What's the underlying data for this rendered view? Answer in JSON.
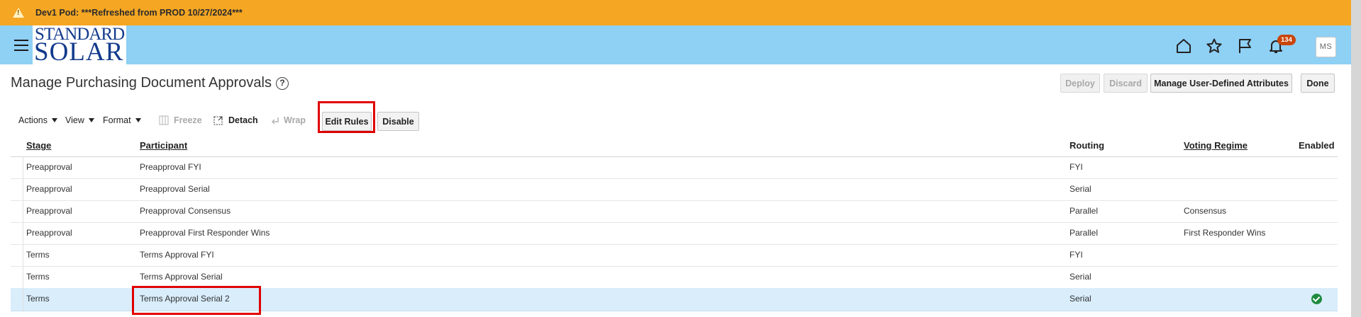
{
  "banner": {
    "text": "Dev1 Pod: ***Refreshed from PROD 10/27/2024***"
  },
  "header": {
    "logo_line1": "STANDARD",
    "logo_line2": "SOLAR",
    "notifications_count": "134",
    "user_initials": "MS",
    "icons": [
      "menu-icon",
      "home-icon",
      "star-icon",
      "flag-icon",
      "bell-icon"
    ]
  },
  "page": {
    "title": "Manage Purchasing Document Approvals"
  },
  "actions": {
    "deploy": "Deploy",
    "discard": "Discard",
    "manage_attrs": "Manage User-Defined Attributes",
    "done": "Done"
  },
  "toolbar": {
    "actions": "Actions",
    "view": "View",
    "format": "Format",
    "freeze": "Freeze",
    "detach": "Detach",
    "wrap": "Wrap",
    "edit_rules": "Edit Rules",
    "disable": "Disable"
  },
  "table": {
    "columns": [
      "Stage",
      "Participant",
      "Routing",
      "Voting Regime",
      "Enabled"
    ],
    "rows": [
      {
        "stage": "Preapproval",
        "participant": "Preapproval FYI",
        "routing": "FYI",
        "voting": "",
        "enabled": false
      },
      {
        "stage": "Preapproval",
        "participant": "Preapproval Serial",
        "routing": "Serial",
        "voting": "",
        "enabled": false
      },
      {
        "stage": "Preapproval",
        "participant": "Preapproval Consensus",
        "routing": "Parallel",
        "voting": "Consensus",
        "enabled": false
      },
      {
        "stage": "Preapproval",
        "participant": "Preapproval First Responder Wins",
        "routing": "Parallel",
        "voting": "First Responder Wins",
        "enabled": false
      },
      {
        "stage": "Terms",
        "participant": "Terms Approval FYI",
        "routing": "FYI",
        "voting": "",
        "enabled": false
      },
      {
        "stage": "Terms",
        "participant": "Terms Approval Serial",
        "routing": "Serial",
        "voting": "",
        "enabled": false
      },
      {
        "stage": "Terms",
        "participant": "Terms Approval Serial 2",
        "routing": "Serial",
        "voting": "",
        "enabled": true
      }
    ],
    "selected_row_index": 6
  },
  "colors": {
    "banner": "#f5a623",
    "header": "#8fd0f5",
    "brand_blue": "#123a8c",
    "brand_orange": "#f08a1c",
    "highlight_red": "#e00000",
    "selected_row": "#d9edfb",
    "enabled_green": "#1e8a3e"
  }
}
